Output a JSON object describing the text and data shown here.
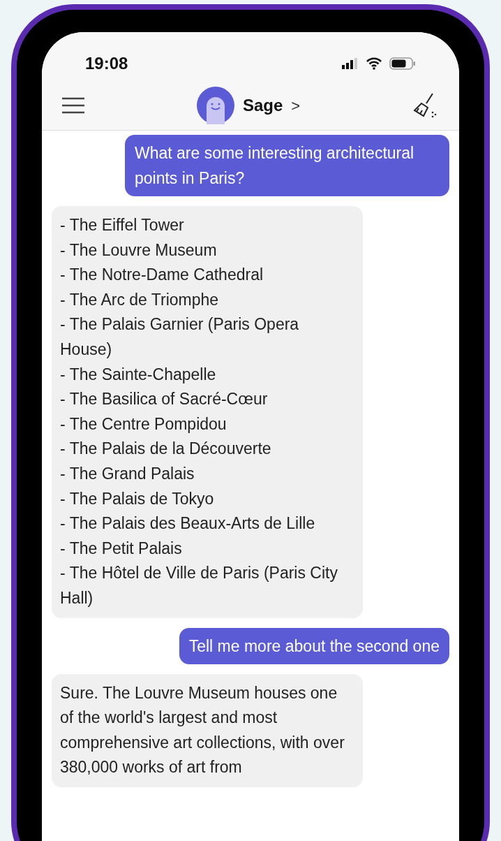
{
  "status_bar": {
    "time": "19:08"
  },
  "header": {
    "bot_name": "Sage",
    "chevron": ">"
  },
  "messages": [
    {
      "kind": "user",
      "text": "What are some interesting architectural points in Paris?"
    },
    {
      "kind": "list",
      "items": [
        "- The Eiffel Tower",
        "- The Louvre Museum",
        "- The Notre-Dame Cathedral",
        "- The Arc de Triomphe",
        "- The Palais Garnier (Paris Opera House)",
        "- The Sainte-Chapelle",
        "- The Basilica of Sacré-Cœur",
        "- The Centre Pompidou",
        "- The Palais de la Découverte",
        "- The Grand Palais",
        "- The Palais de Tokyo",
        "- The Palais des Beaux-Arts de Lille",
        "- The Petit Palais",
        "- The Hôtel de Ville de Paris (Paris City Hall)"
      ]
    },
    {
      "kind": "user",
      "text": "Tell me more about the second one"
    },
    {
      "kind": "bot",
      "text": "Sure. The Louvre Museum houses one of the world's largest and most comprehensive art collections, with over 380,000 works of art from"
    }
  ]
}
